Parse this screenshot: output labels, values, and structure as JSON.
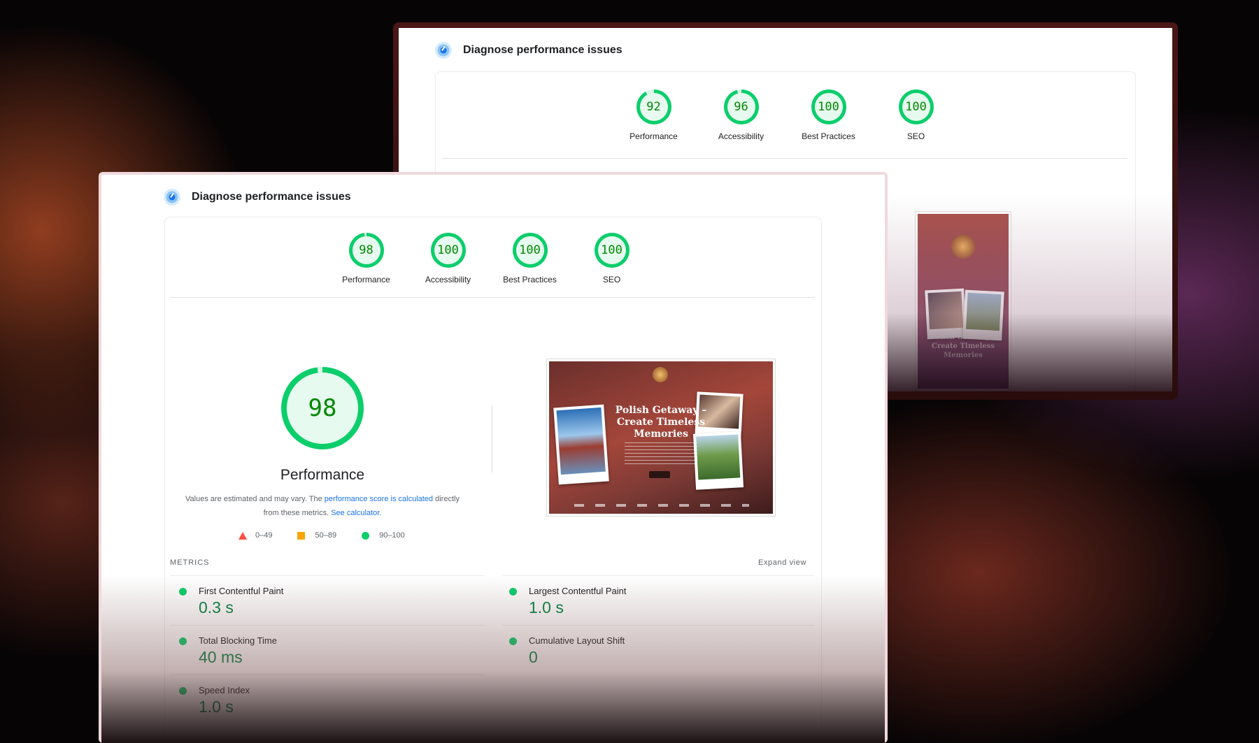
{
  "back_panel": {
    "title": "Diagnose performance issues",
    "gauges": [
      {
        "label": "Performance",
        "score": 92
      },
      {
        "label": "Accessibility",
        "score": 96
      },
      {
        "label": "Best Practices",
        "score": 100
      },
      {
        "label": "SEO",
        "score": 100
      }
    ],
    "mobile_thumbnail": {
      "title": "Polish Getaway – Create Timeless Memories"
    }
  },
  "front_panel": {
    "title": "Diagnose performance issues",
    "gauges": [
      {
        "label": "Performance",
        "score": 98
      },
      {
        "label": "Accessibility",
        "score": 100
      },
      {
        "label": "Best Practices",
        "score": 100
      },
      {
        "label": "SEO",
        "score": 100
      }
    ],
    "main_score": {
      "score": 98,
      "label": "Performance"
    },
    "note": {
      "text_before": "Values are estimated and may vary. The ",
      "link_score": "performance score is calculated",
      "text_middle": " directly from these metrics. ",
      "link_calculator": "See calculator."
    },
    "legend": [
      {
        "shape": "triangle",
        "range": "0–49",
        "color": "#ff4e42"
      },
      {
        "shape": "square",
        "range": "50–89",
        "color": "#ffa400"
      },
      {
        "shape": "circle",
        "range": "90–100",
        "color": "#0cce6b"
      }
    ],
    "metrics_label": "METRICS",
    "expand_label": "Expand view",
    "metrics": [
      {
        "name": "First Contentful Paint",
        "value": "0.3 s"
      },
      {
        "name": "Largest Contentful Paint",
        "value": "1.0 s"
      },
      {
        "name": "Total Blocking Time",
        "value": "40 ms"
      },
      {
        "name": "Cumulative Layout Shift",
        "value": "0"
      },
      {
        "name": "Speed Index",
        "value": "1.0 s"
      }
    ],
    "thumbnail": {
      "title": "Polish Getaway – Create Timeless Memories"
    }
  },
  "colors": {
    "pass_green": "#0cce6b",
    "score_text": "#008800",
    "link_blue": "#1a73e8"
  }
}
